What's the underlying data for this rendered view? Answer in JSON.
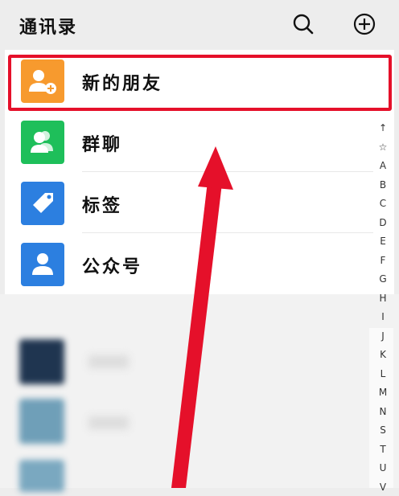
{
  "header": {
    "title": "通讯录",
    "search_icon": "search-icon",
    "add_icon": "plus-circle-icon"
  },
  "rows": [
    {
      "label": "新的朋友",
      "icon": "add-friend-icon",
      "color": "#f79a2e"
    },
    {
      "label": "群聊",
      "icon": "group-icon",
      "color": "#1ebf5a"
    },
    {
      "label": "标签",
      "icon": "tag-icon",
      "color": "#2c7fe0"
    },
    {
      "label": "公众号",
      "icon": "official-account-icon",
      "color": "#2c7fe0"
    }
  ],
  "index_letters": [
    "↑",
    "☆",
    "A",
    "B",
    "C",
    "D",
    "E",
    "F",
    "G",
    "H",
    "I",
    "J",
    "K",
    "L",
    "M",
    "N",
    "S",
    "T",
    "U",
    "V"
  ],
  "annotation": {
    "highlight_color": "#e5102a",
    "arrow_color": "#e5102a"
  }
}
